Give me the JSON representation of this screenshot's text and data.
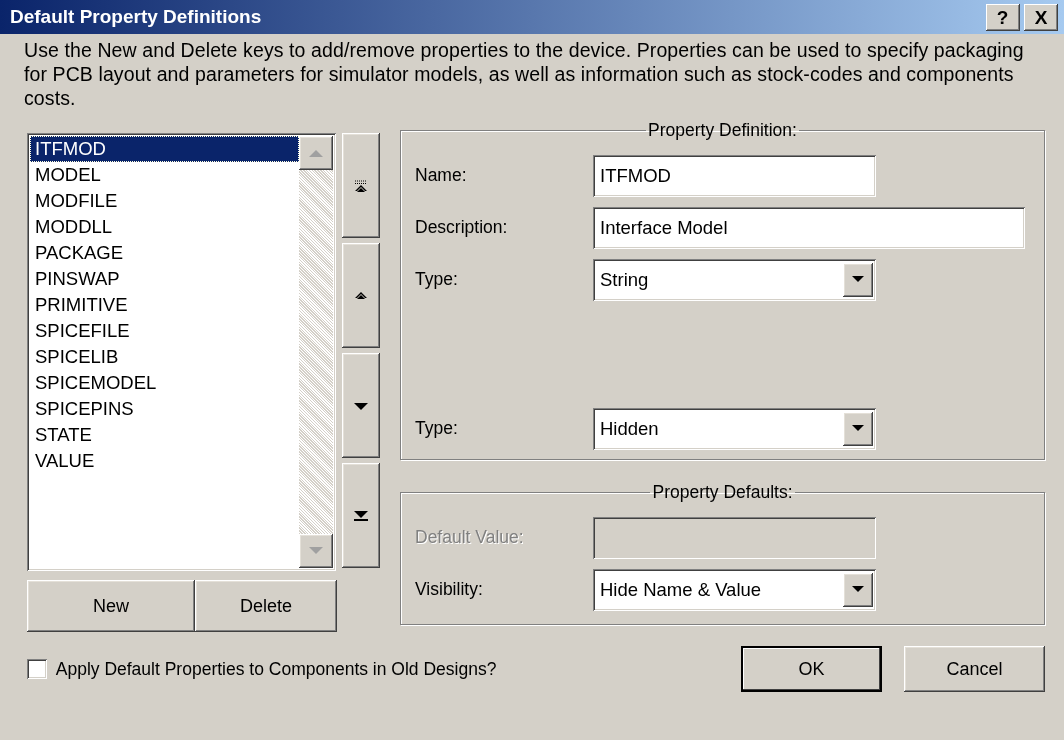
{
  "window": {
    "title": "Default Property Definitions",
    "controls": [
      "?",
      "X"
    ]
  },
  "intro": "Use the New and Delete keys to add/remove properties to the device. Properties can be used to specify packaging for PCB layout and parameters for simulator models, as well as information such as stock-codes and components costs.",
  "properties": [
    {
      "label": "ITFMOD",
      "selected": true
    },
    {
      "label": "MODEL",
      "selected": false
    },
    {
      "label": "MODFILE",
      "selected": false
    },
    {
      "label": "MODDLL",
      "selected": false
    },
    {
      "label": "PACKAGE",
      "selected": false
    },
    {
      "label": "PINSWAP",
      "selected": false
    },
    {
      "label": "PRIMITIVE",
      "selected": false
    },
    {
      "label": "SPICEFILE",
      "selected": false
    },
    {
      "label": "SPICELIB",
      "selected": false
    },
    {
      "label": "SPICEMODEL",
      "selected": false
    },
    {
      "label": "SPICEPINS",
      "selected": false
    },
    {
      "label": "STATE",
      "selected": false
    },
    {
      "label": "VALUE",
      "selected": false
    }
  ],
  "order_buttons": [
    {
      "kind": "top"
    },
    {
      "kind": "up"
    },
    {
      "kind": "down"
    },
    {
      "kind": "bottom"
    }
  ],
  "list_buttons": [
    "New",
    "Delete"
  ],
  "property_definition": {
    "title": "Property Definition:",
    "fields": [
      {
        "label": "Name:",
        "kind": "text",
        "value": "ITFMOD",
        "disabled": false
      },
      {
        "label": "Description:",
        "kind": "wide_text",
        "value": "Interface Model",
        "disabled": false
      },
      {
        "label": "Type:",
        "kind": "select",
        "value": "String",
        "disabled": false
      }
    ],
    "lower_fields": [
      {
        "label": "Type:",
        "kind": "select",
        "value": "Hidden",
        "disabled": false
      }
    ]
  },
  "property_defaults": {
    "title": "Property Defaults:",
    "fields": [
      {
        "label": "Default Value:",
        "kind": "text",
        "disabled": true
      },
      {
        "label": "Visibility:",
        "kind": "select",
        "value": "Hide Name & Value",
        "disabled": false
      }
    ]
  },
  "apply_old_designs": {
    "label": "Apply Default Properties to Components in Old Designs?",
    "checked": false
  },
  "dialog_buttons": [
    {
      "label": "OK",
      "default": true
    },
    {
      "label": "Cancel",
      "default": false
    }
  ]
}
